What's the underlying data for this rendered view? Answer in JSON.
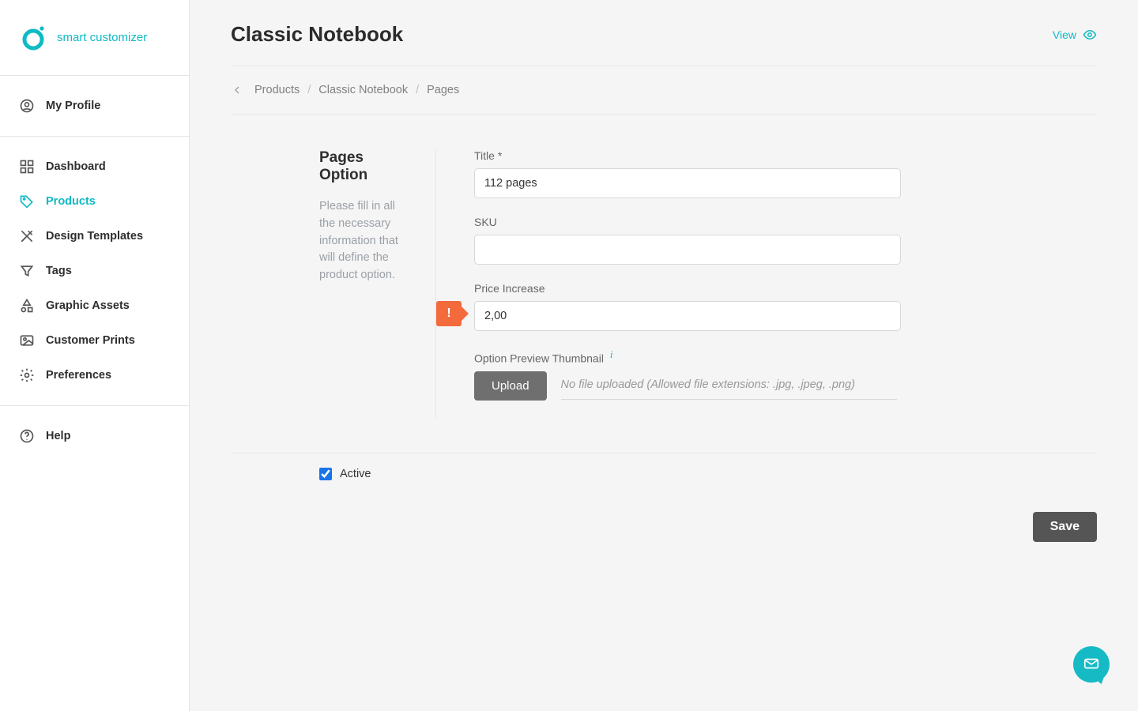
{
  "brand": {
    "name": "smart customizer"
  },
  "sidebar": {
    "profile": "My Profile",
    "items": [
      {
        "label": "Dashboard"
      },
      {
        "label": "Products"
      },
      {
        "label": "Design Templates"
      },
      {
        "label": "Tags"
      },
      {
        "label": "Graphic Assets"
      },
      {
        "label": "Customer Prints"
      },
      {
        "label": "Preferences"
      }
    ],
    "help": "Help"
  },
  "header": {
    "title": "Classic Notebook",
    "view_label": "View"
  },
  "breadcrumb": {
    "items": [
      "Products",
      "Classic Notebook",
      "Pages"
    ]
  },
  "panel": {
    "heading": "Pages Option",
    "description": "Please fill in all the necessary information that will define the product option."
  },
  "form": {
    "title_label": "Title *",
    "title_value": "112 pages",
    "sku_label": "SKU",
    "sku_value": "",
    "price_label": "Price Increase",
    "price_value": "2,00",
    "thumb_label": "Option Preview Thumbnail",
    "upload_label": "Upload",
    "nofile_text": "No file uploaded (Allowed file extensions: .jpg, .jpeg, .png)",
    "active_label": "Active",
    "active_checked": true,
    "save_label": "Save",
    "warn_icon": "!"
  }
}
